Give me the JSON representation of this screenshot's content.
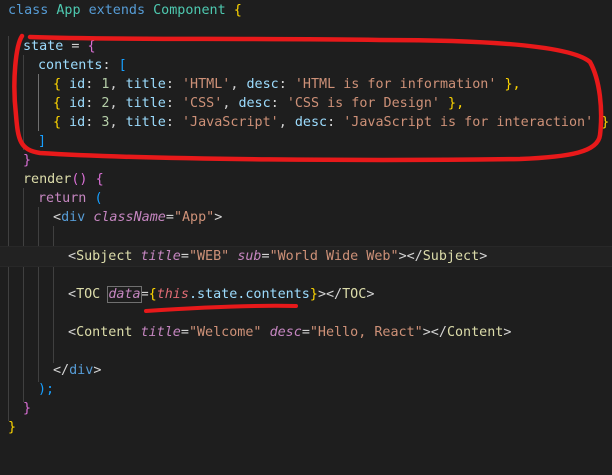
{
  "code": {
    "l1": {
      "kw": "class",
      "name": "App",
      "ext": "extends",
      "base": "Component",
      "brace": "{"
    },
    "l2": {
      "prop": "state",
      "op": "=",
      "brace": "{"
    },
    "l3": {
      "prop": "contents",
      "colon": ":",
      "bracket": "["
    },
    "items": [
      {
        "id": "1",
        "title": "'HTML'",
        "desc": "'HTML is for information'",
        "end": " },"
      },
      {
        "id": "2",
        "title": "'CSS'",
        "desc": "'CSS is for Design'",
        "end": " },"
      },
      {
        "id": "3",
        "title": "'JavaScript'",
        "desc": "'JavaScript is for interaction'",
        "end": " }"
      }
    ],
    "labels": {
      "id": "id",
      "title": "title",
      "desc": "desc",
      "open": "{ ",
      "colon": ": ",
      "comma": ", "
    },
    "l7": {
      "bracket": "]"
    },
    "l8": {
      "brace": "}"
    },
    "l9": {
      "fn": "render",
      "parens": "()",
      "brace": "{"
    },
    "l10": {
      "kw": "return",
      "paren": "("
    },
    "l11": {
      "tag": "div",
      "attr": "className",
      "val": "\"App\""
    },
    "l13": {
      "tag": "Subject",
      "attr1": "title",
      "val1": "\"WEB\"",
      "attr2": "sub",
      "val2": "\"World Wide Web\"",
      "close": "Subject"
    },
    "l15": {
      "tag": "TOC",
      "attr": "data",
      "this": "this",
      "rest": ".state.contents",
      "close": "TOC"
    },
    "l17": {
      "tag": "Content",
      "attr1": "title",
      "val1": "\"Welcome\"",
      "attr2": "desc",
      "val2": "\"Hello, React\"",
      "close": "Content"
    },
    "l19": {
      "close": "div"
    },
    "l20": {
      "text": ");"
    },
    "l21": {
      "brace": "}"
    },
    "l22": {
      "brace": "}"
    }
  },
  "colors": {
    "background": "#1e1e1e",
    "annotation": "#e8191a"
  }
}
